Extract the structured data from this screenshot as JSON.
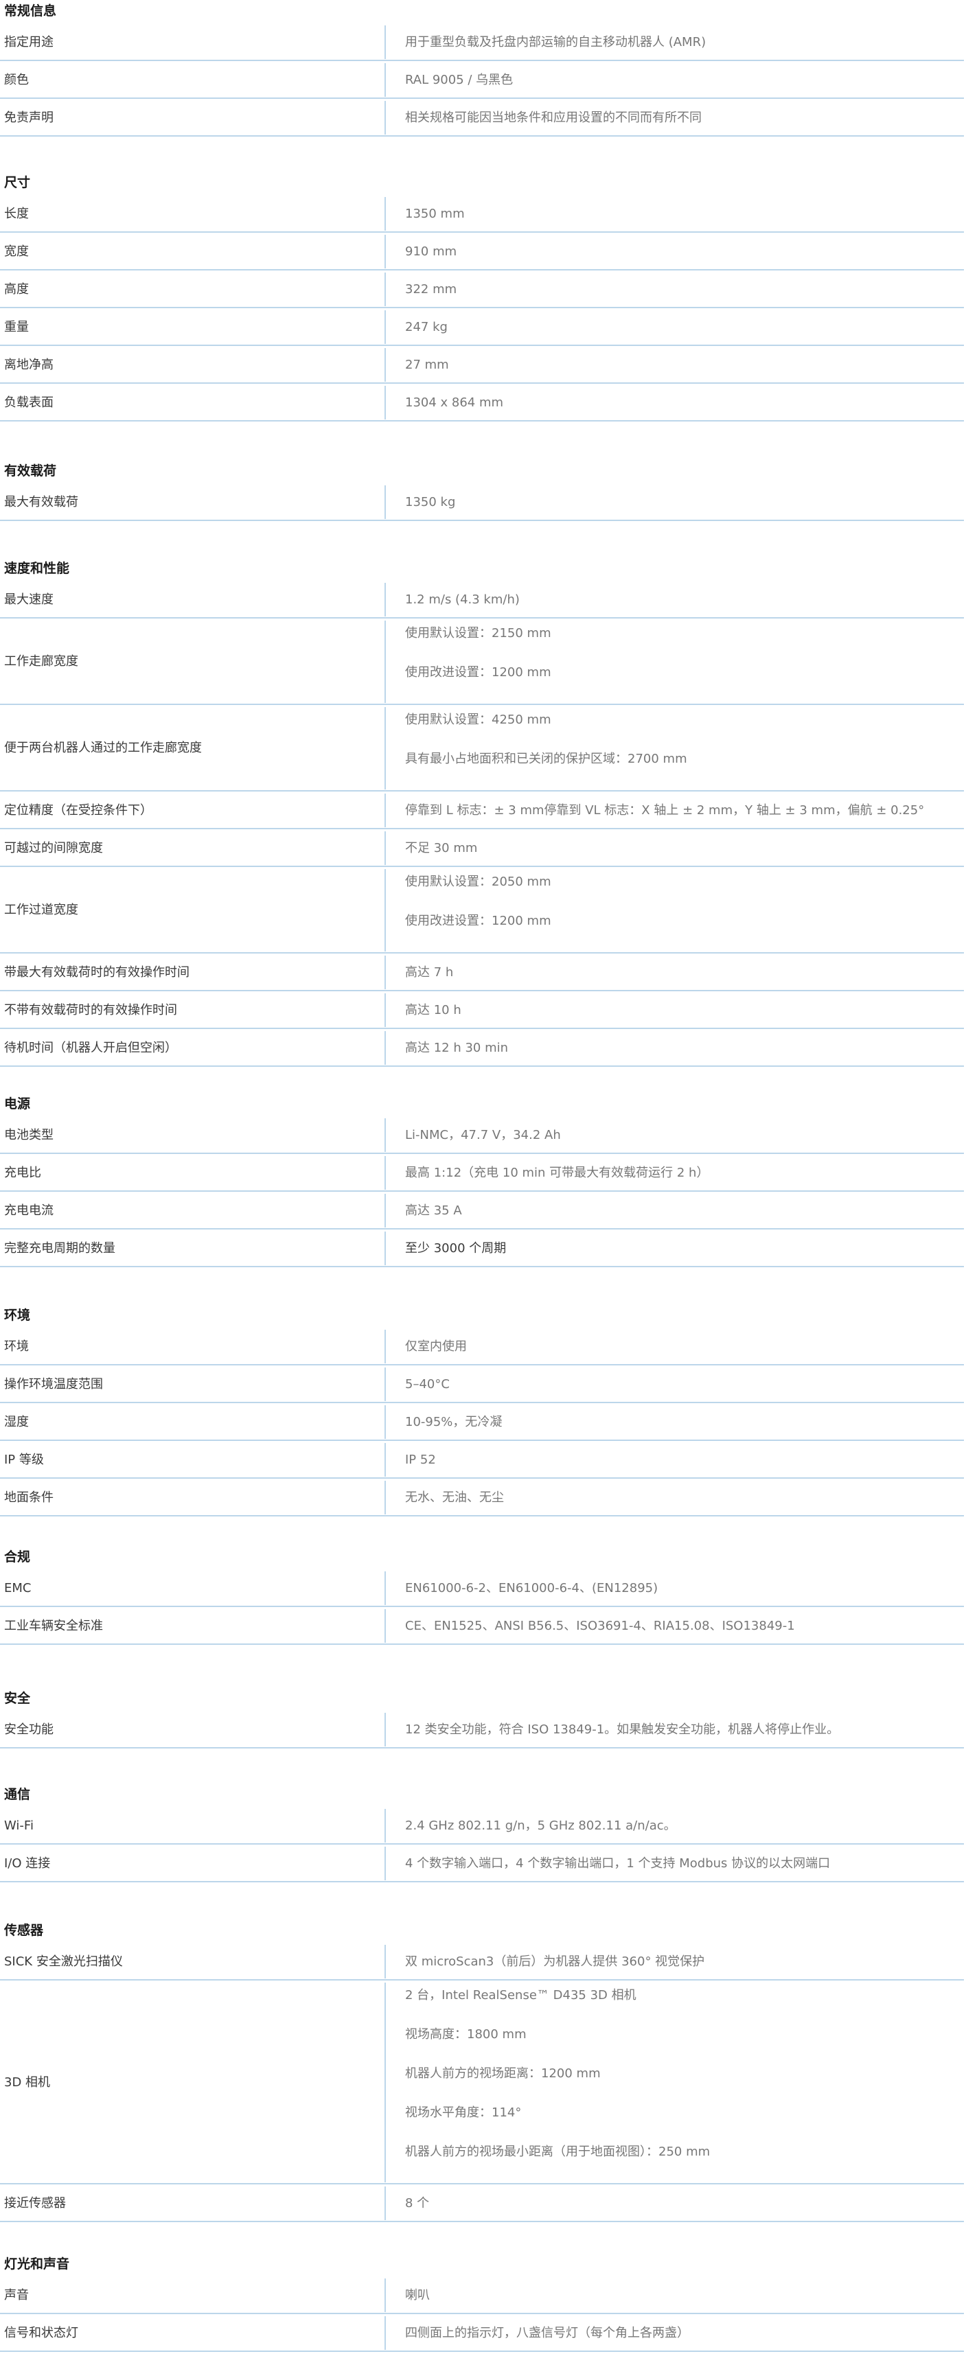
{
  "sections": [
    {
      "title": "常规信息",
      "rows": [
        {
          "label": "指定用途",
          "values": [
            "用于重型负载及托盘内部运输的自主移动机器人 (AMR)"
          ]
        },
        {
          "label": "颜色",
          "values": [
            "RAL 9005 / 乌黑色"
          ]
        },
        {
          "label": "免责声明",
          "values": [
            "相关规格可能因当地条件和应用设置的不同而有所不同"
          ]
        }
      ]
    },
    {
      "title": "尺寸",
      "rows": [
        {
          "label": "长度",
          "values": [
            "1350 mm"
          ]
        },
        {
          "label": "宽度",
          "values": [
            "910 mm"
          ]
        },
        {
          "label": "高度",
          "values": [
            "322 mm"
          ]
        },
        {
          "label": "重量",
          "values": [
            "247 kg"
          ]
        },
        {
          "label": "离地净高",
          "values": [
            "27 mm"
          ]
        },
        {
          "label": "负载表面",
          "values": [
            "1304 x 864 mm"
          ]
        }
      ]
    },
    {
      "title": "有效载荷",
      "rows": [
        {
          "label": "最大有效载荷",
          "values": [
            "1350 kg"
          ]
        }
      ]
    },
    {
      "title": "速度和性能",
      "rows": [
        {
          "label": "最大速度",
          "values": [
            "1.2 m/s (4.3 km/h)"
          ]
        },
        {
          "label": "工作走廊宽度",
          "values": [
            "使用默认设置：2150 mm",
            "使用改进设置：1200 mm"
          ]
        },
        {
          "label": "便于两台机器人通过的工作走廊宽度",
          "values": [
            "使用默认设置：4250 mm",
            "具有最小占地面积和已关闭的保护区域：2700 mm"
          ]
        },
        {
          "label": "定位精度（在受控条件下）",
          "values": [
            "停靠到 L 标志：± 3 mm停靠到 VL 标志：X 轴上 ± 2 mm，Y 轴上 ± 3 mm，偏航 ± 0.25°"
          ]
        },
        {
          "label": "可越过的间隙宽度",
          "values": [
            "不足 30 mm"
          ]
        },
        {
          "label": "工作过道宽度",
          "values": [
            "使用默认设置：2050 mm",
            "使用改进设置：1200 mm"
          ]
        },
        {
          "label": "带最大有效载荷时的有效操作时间",
          "values": [
            "高达 7 h"
          ]
        },
        {
          "label": "不带有效载荷时的有效操作时间",
          "values": [
            "高达 10 h"
          ]
        },
        {
          "label": "待机时间（机器人开启但空闲）",
          "values": [
            "高达 12 h 30 min"
          ]
        }
      ]
    },
    {
      "title": "电源",
      "rows": [
        {
          "label": "电池类型",
          "values": [
            "Li-NMC，47.7 V，34.2 Ah"
          ]
        },
        {
          "label": "充电比",
          "values": [
            "最高 1:12（充电 10 min 可带最大有效载荷运行 2 h）"
          ]
        },
        {
          "label": "充电电流",
          "values": [
            "高达 35 A"
          ]
        },
        {
          "label": "完整充电周期的数量",
          "values": [
            "至少 3000 个周期"
          ],
          "dark": true
        }
      ]
    },
    {
      "title": "环境",
      "rows": [
        {
          "label": "环境",
          "values": [
            "仅室内使用"
          ]
        },
        {
          "label": "操作环境温度范围",
          "values": [
            "5–40°C"
          ]
        },
        {
          "label": "湿度",
          "values": [
            "10-95%，无冷凝"
          ]
        },
        {
          "label": "IP 等级",
          "values": [
            "IP 52"
          ]
        },
        {
          "label": "地面条件",
          "values": [
            "无水、无油、无尘"
          ]
        }
      ]
    },
    {
      "title": "合规",
      "rows": [
        {
          "label": "EMC",
          "values": [
            "EN61000-6-2、EN61000-6-4、(EN12895)"
          ]
        },
        {
          "label": "工业车辆安全标准",
          "values": [
            "CE、EN1525、ANSI B56.5、ISO3691-4、RIA15.08、ISO13849-1"
          ]
        }
      ]
    },
    {
      "title": "安全",
      "rows": [
        {
          "label": "安全功能",
          "values": [
            "12 类安全功能，符合 ISO 13849-1。如果触发安全功能，机器人将停止作业。"
          ]
        }
      ]
    },
    {
      "title": "通信",
      "rows": [
        {
          "label": "Wi-Fi",
          "values": [
            "2.4 GHz 802.11 g/n，5 GHz 802.11 a/n/ac。"
          ]
        },
        {
          "label": "I/O 连接",
          "values": [
            "4 个数字输入端口，4 个数字输出端口，1 个支持 Modbus 协议的以太网端口"
          ]
        }
      ]
    },
    {
      "title": "传感器",
      "rows": [
        {
          "label": "SICK 安全激光扫描仪",
          "values": [
            "双 microScan3（前后）为机器人提供 360° 视觉保护"
          ]
        },
        {
          "label": "3D 相机",
          "values": [
            "2 台，Intel RealSense™ D435 3D 相机",
            "视场高度：1800 mm",
            "机器人前方的视场距离：1200 mm",
            "视场水平角度：114°",
            "机器人前方的视场最小距离（用于地面视图）：250 mm"
          ]
        },
        {
          "label": "接近传感器",
          "values": [
            "8 个"
          ]
        }
      ]
    },
    {
      "title": "灯光和声音",
      "rows": [
        {
          "label": "声音",
          "values": [
            "喇叭"
          ]
        },
        {
          "label": "信号和状态灯",
          "values": [
            "四侧面上的指示灯，八盏信号灯（每个角上各两盏）"
          ]
        }
      ]
    }
  ]
}
